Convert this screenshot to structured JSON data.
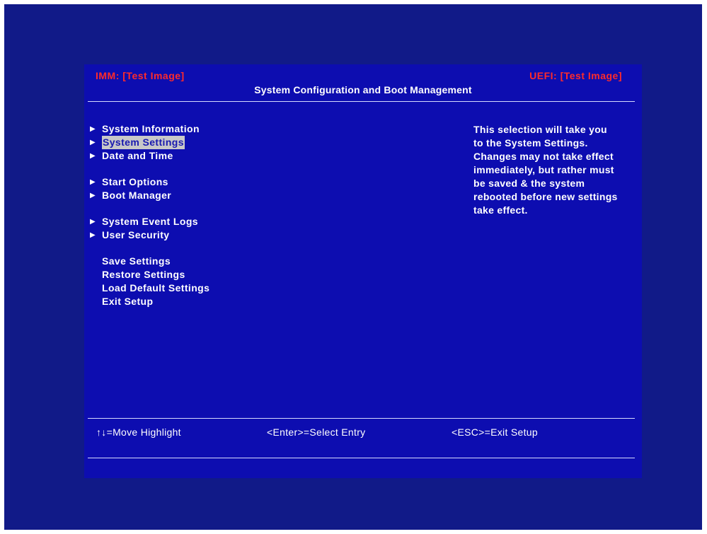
{
  "header": {
    "left": "IMM: [Test Image]",
    "right": "UEFI: [Test Image]",
    "title": "System Configuration and Boot Management"
  },
  "menu": [
    {
      "label": "System Information",
      "arrow": "▶",
      "selected": false
    },
    {
      "label": "System Settings",
      "arrow": "▶",
      "selected": true
    },
    {
      "label": "Date and Time",
      "arrow": "▶",
      "selected": false
    },
    {
      "label": "Start Options",
      "arrow": "▶",
      "selected": false
    },
    {
      "label": "Boot Manager",
      "arrow": "▶",
      "selected": false
    },
    {
      "label": "System Event Logs",
      "arrow": "▶",
      "selected": false
    },
    {
      "label": "User Security",
      "arrow": "▶",
      "selected": false
    },
    {
      "label": "Save Settings",
      "arrow": "",
      "selected": false
    },
    {
      "label": "Restore Settings",
      "arrow": "",
      "selected": false
    },
    {
      "label": "Load Default Settings",
      "arrow": "",
      "selected": false
    },
    {
      "label": "Exit Setup",
      "arrow": "",
      "selected": false
    }
  ],
  "help": {
    "lines": [
      "This selection will take you",
      "to the System Settings.",
      "Changes may not take effect",
      "immediately, but rather must",
      "be saved & the system",
      "rebooted before new settings",
      "take effect."
    ]
  },
  "footer": {
    "move": "↑↓=Move Highlight",
    "select": "<Enter>=Select Entry",
    "exit": "<ESC>=Exit Setup"
  },
  "colors": {
    "outer_background": "#111a88",
    "panel_background": "#0d0db0",
    "header_accent": "#ff2b2b",
    "text": "#ffffff",
    "highlight_background": "#c8c8c8",
    "highlight_text": "#1818b0"
  }
}
